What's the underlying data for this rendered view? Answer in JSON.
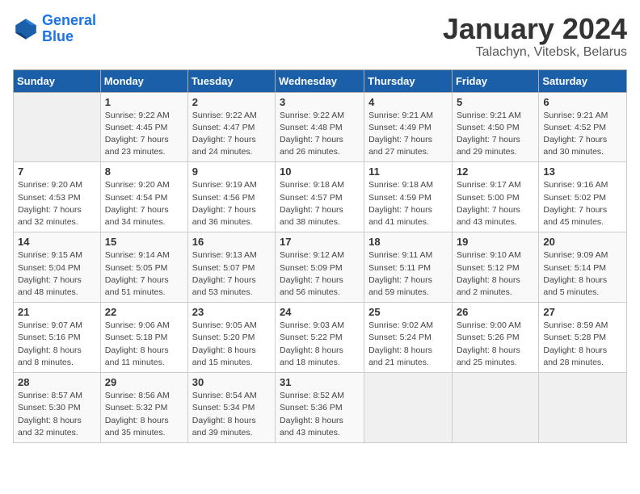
{
  "header": {
    "logo_line1": "General",
    "logo_line2": "Blue",
    "month": "January 2024",
    "location": "Talachyn, Vitebsk, Belarus"
  },
  "weekdays": [
    "Sunday",
    "Monday",
    "Tuesday",
    "Wednesday",
    "Thursday",
    "Friday",
    "Saturday"
  ],
  "weeks": [
    [
      {
        "day": "",
        "info": ""
      },
      {
        "day": "1",
        "info": "Sunrise: 9:22 AM\nSunset: 4:45 PM\nDaylight: 7 hours\nand 23 minutes."
      },
      {
        "day": "2",
        "info": "Sunrise: 9:22 AM\nSunset: 4:47 PM\nDaylight: 7 hours\nand 24 minutes."
      },
      {
        "day": "3",
        "info": "Sunrise: 9:22 AM\nSunset: 4:48 PM\nDaylight: 7 hours\nand 26 minutes."
      },
      {
        "day": "4",
        "info": "Sunrise: 9:21 AM\nSunset: 4:49 PM\nDaylight: 7 hours\nand 27 minutes."
      },
      {
        "day": "5",
        "info": "Sunrise: 9:21 AM\nSunset: 4:50 PM\nDaylight: 7 hours\nand 29 minutes."
      },
      {
        "day": "6",
        "info": "Sunrise: 9:21 AM\nSunset: 4:52 PM\nDaylight: 7 hours\nand 30 minutes."
      }
    ],
    [
      {
        "day": "7",
        "info": "Sunrise: 9:20 AM\nSunset: 4:53 PM\nDaylight: 7 hours\nand 32 minutes."
      },
      {
        "day": "8",
        "info": "Sunrise: 9:20 AM\nSunset: 4:54 PM\nDaylight: 7 hours\nand 34 minutes."
      },
      {
        "day": "9",
        "info": "Sunrise: 9:19 AM\nSunset: 4:56 PM\nDaylight: 7 hours\nand 36 minutes."
      },
      {
        "day": "10",
        "info": "Sunrise: 9:18 AM\nSunset: 4:57 PM\nDaylight: 7 hours\nand 38 minutes."
      },
      {
        "day": "11",
        "info": "Sunrise: 9:18 AM\nSunset: 4:59 PM\nDaylight: 7 hours\nand 41 minutes."
      },
      {
        "day": "12",
        "info": "Sunrise: 9:17 AM\nSunset: 5:00 PM\nDaylight: 7 hours\nand 43 minutes."
      },
      {
        "day": "13",
        "info": "Sunrise: 9:16 AM\nSunset: 5:02 PM\nDaylight: 7 hours\nand 45 minutes."
      }
    ],
    [
      {
        "day": "14",
        "info": "Sunrise: 9:15 AM\nSunset: 5:04 PM\nDaylight: 7 hours\nand 48 minutes."
      },
      {
        "day": "15",
        "info": "Sunrise: 9:14 AM\nSunset: 5:05 PM\nDaylight: 7 hours\nand 51 minutes."
      },
      {
        "day": "16",
        "info": "Sunrise: 9:13 AM\nSunset: 5:07 PM\nDaylight: 7 hours\nand 53 minutes."
      },
      {
        "day": "17",
        "info": "Sunrise: 9:12 AM\nSunset: 5:09 PM\nDaylight: 7 hours\nand 56 minutes."
      },
      {
        "day": "18",
        "info": "Sunrise: 9:11 AM\nSunset: 5:11 PM\nDaylight: 7 hours\nand 59 minutes."
      },
      {
        "day": "19",
        "info": "Sunrise: 9:10 AM\nSunset: 5:12 PM\nDaylight: 8 hours\nand 2 minutes."
      },
      {
        "day": "20",
        "info": "Sunrise: 9:09 AM\nSunset: 5:14 PM\nDaylight: 8 hours\nand 5 minutes."
      }
    ],
    [
      {
        "day": "21",
        "info": "Sunrise: 9:07 AM\nSunset: 5:16 PM\nDaylight: 8 hours\nand 8 minutes."
      },
      {
        "day": "22",
        "info": "Sunrise: 9:06 AM\nSunset: 5:18 PM\nDaylight: 8 hours\nand 11 minutes."
      },
      {
        "day": "23",
        "info": "Sunrise: 9:05 AM\nSunset: 5:20 PM\nDaylight: 8 hours\nand 15 minutes."
      },
      {
        "day": "24",
        "info": "Sunrise: 9:03 AM\nSunset: 5:22 PM\nDaylight: 8 hours\nand 18 minutes."
      },
      {
        "day": "25",
        "info": "Sunrise: 9:02 AM\nSunset: 5:24 PM\nDaylight: 8 hours\nand 21 minutes."
      },
      {
        "day": "26",
        "info": "Sunrise: 9:00 AM\nSunset: 5:26 PM\nDaylight: 8 hours\nand 25 minutes."
      },
      {
        "day": "27",
        "info": "Sunrise: 8:59 AM\nSunset: 5:28 PM\nDaylight: 8 hours\nand 28 minutes."
      }
    ],
    [
      {
        "day": "28",
        "info": "Sunrise: 8:57 AM\nSunset: 5:30 PM\nDaylight: 8 hours\nand 32 minutes."
      },
      {
        "day": "29",
        "info": "Sunrise: 8:56 AM\nSunset: 5:32 PM\nDaylight: 8 hours\nand 35 minutes."
      },
      {
        "day": "30",
        "info": "Sunrise: 8:54 AM\nSunset: 5:34 PM\nDaylight: 8 hours\nand 39 minutes."
      },
      {
        "day": "31",
        "info": "Sunrise: 8:52 AM\nSunset: 5:36 PM\nDaylight: 8 hours\nand 43 minutes."
      },
      {
        "day": "",
        "info": ""
      },
      {
        "day": "",
        "info": ""
      },
      {
        "day": "",
        "info": ""
      }
    ]
  ]
}
